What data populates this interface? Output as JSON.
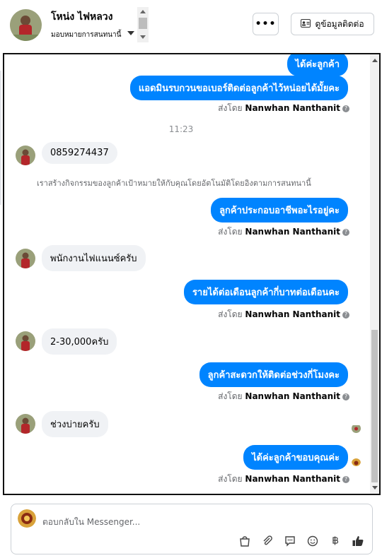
{
  "header": {
    "name": "โหน่ง ไฟหลวง",
    "assign_label": "มอบหมายการสนทนานี้",
    "more_label": "•••",
    "contact_label": "ดูข้อมูลติดต่อ"
  },
  "messages": {
    "out0": "ได้ค่ะลูกค้า",
    "out1": "แอดมินรบกวนขอเบอร์ติดต่อลูกค้าไว้หน่อยได้มั้ยคะ",
    "sent_prefix": "ส่งโดย",
    "sent_by": "Nanwhan Nanthanit",
    "time": "11:23",
    "in1": "0859274437",
    "note": "เราสร้างกิจกรรมของลูกค้าเป้าหมายให้กับคุณโดยอัตโนมัติโดยอิงตามการสนทนานี้",
    "out2": "ลูกค้าประกอบอาชีพอะไรอยู่คะ",
    "in2": "พนักงานไฟแนนซ์ครับ",
    "out3": "รายได้ต่อเดือนลูกค้ากี่บาทต่อเดือนคะ",
    "in3": "2-30,000ครับ",
    "out4": "ลูกค้าสะดวกให้ติดต่อช่วงกี่โมงคะ",
    "in4": "ช่วงบ่ายครับ",
    "out5": "ได้ค่ะลูกค้าขอบคุณค่ะ"
  },
  "reply": {
    "placeholder": "ตอบกลับใน Messenger..."
  },
  "colors": {
    "accent": "#0084ff",
    "incoming": "#f0f2f5"
  }
}
